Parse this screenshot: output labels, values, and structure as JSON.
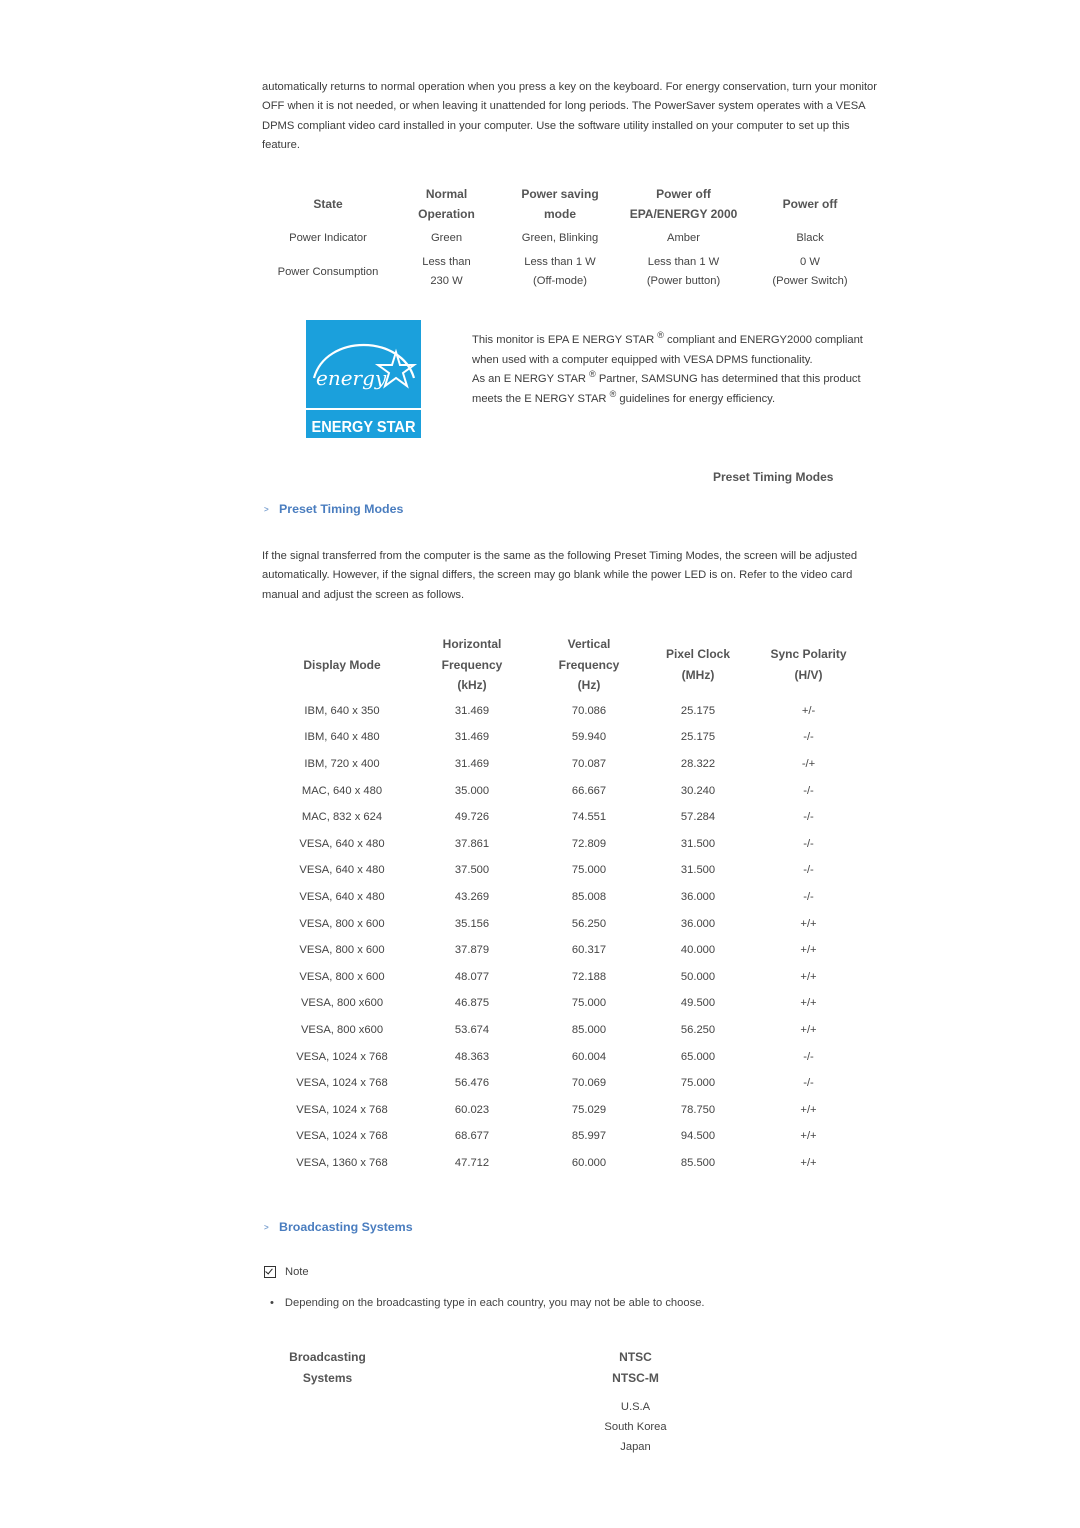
{
  "intro_paragraph": "automatically returns to normal operation when you press a key on the keyboard. For energy conservation, turn your monitor OFF when it is not needed, or when leaving it unattended for long periods. The PowerSaver system operates with a VESA DPMS compliant video card installed in your computer. Use the software utility installed on your computer to set up this feature.",
  "power_table": {
    "headers": [
      {
        "line1": "State",
        "line2": ""
      },
      {
        "line1": "Normal",
        "line2": "Operation"
      },
      {
        "line1": "Power saving",
        "line2": "mode"
      },
      {
        "line1": "Power off",
        "line2": "EPA/ENERGY 2000"
      },
      {
        "line1": "Power off",
        "line2": ""
      }
    ],
    "rows": [
      {
        "label": "Power Indicator",
        "cells": [
          {
            "line1": "Green",
            "line2": ""
          },
          {
            "line1": "Green, Blinking",
            "line2": ""
          },
          {
            "line1": "Amber",
            "line2": ""
          },
          {
            "line1": "Black",
            "line2": ""
          }
        ]
      },
      {
        "label": "Power Consumption",
        "cells": [
          {
            "line1": "Less than",
            "line2": "230 W"
          },
          {
            "line1": "Less than 1 W",
            "line2": "(Off-mode)"
          },
          {
            "line1": "Less than 1 W",
            "line2": "(Power button)"
          },
          {
            "line1": "0 W",
            "line2": "(Power Switch)"
          }
        ]
      }
    ]
  },
  "energy_star": {
    "logo_script": "energy",
    "logo_label": "ENERGY STAR",
    "brand_color": "#1ba0dc",
    "p1_a": "This monitor is EPA E NERGY STAR",
    "p1_b": " compliant and ENERGY2000 compliant when used with a computer equipped with VESA DPMS functionality.",
    "p2_a": "As an E NERGY STAR",
    "p2_b": " Partner, SAMSUNG has determined that this product meets the E NERGY STAR",
    "p2_c": " guidelines for energy efficiency.",
    "reg_mark": "®"
  },
  "right_heading": "Preset Timing Modes",
  "section_preset": {
    "arrow": ">",
    "title": "Preset Timing Modes",
    "paragraph": "If the signal transferred from the computer is the same as the following Preset Timing Modes, the screen will be adjusted automatically. However, if the signal differs, the screen may go blank while the power LED is on. Refer to the video card manual and adjust the screen as follows."
  },
  "timing_table": {
    "headers": [
      {
        "lines": [
          "Display Mode"
        ]
      },
      {
        "lines": [
          "Horizontal",
          "Frequency",
          "(kHz)"
        ]
      },
      {
        "lines": [
          "Vertical",
          "Frequency",
          "(Hz)"
        ]
      },
      {
        "lines": [
          "Pixel Clock",
          "(MHz)"
        ]
      },
      {
        "lines": [
          "Sync Polarity",
          "(H/V)"
        ]
      }
    ],
    "rows": [
      [
        "IBM, 640 x 350",
        "31.469",
        "70.086",
        "25.175",
        "+/-"
      ],
      [
        "IBM, 640 x 480",
        "31.469",
        "59.940",
        "25.175",
        "-/-"
      ],
      [
        "IBM, 720 x 400",
        "31.469",
        "70.087",
        "28.322",
        "-/+"
      ],
      [
        "MAC, 640 x 480",
        "35.000",
        "66.667",
        "30.240",
        "-/-"
      ],
      [
        "MAC, 832 x 624",
        "49.726",
        "74.551",
        "57.284",
        "-/-"
      ],
      [
        "VESA, 640 x 480",
        "37.861",
        "72.809",
        "31.500",
        "-/-"
      ],
      [
        "VESA, 640 x 480",
        "37.500",
        "75.000",
        "31.500",
        "-/-"
      ],
      [
        "VESA, 640 x 480",
        "43.269",
        "85.008",
        "36.000",
        "-/-"
      ],
      [
        "VESA, 800 x 600",
        "35.156",
        "56.250",
        "36.000",
        "+/+"
      ],
      [
        "VESA, 800 x 600",
        "37.879",
        "60.317",
        "40.000",
        "+/+"
      ],
      [
        "VESA, 800 x 600",
        "48.077",
        "72.188",
        "50.000",
        "+/+"
      ],
      [
        "VESA, 800 x600",
        "46.875",
        "75.000",
        "49.500",
        "+/+"
      ],
      [
        "VESA, 800 x600",
        "53.674",
        "85.000",
        "56.250",
        "+/+"
      ],
      [
        "VESA, 1024 x 768",
        "48.363",
        "60.004",
        "65.000",
        "-/-"
      ],
      [
        "VESA, 1024 x 768",
        "56.476",
        "70.069",
        "75.000",
        "-/-"
      ],
      [
        "VESA, 1024 x 768",
        "60.023",
        "75.029",
        "78.750",
        "+/+"
      ],
      [
        "VESA, 1024 x 768",
        "68.677",
        "85.997",
        "94.500",
        "+/+"
      ],
      [
        "VESA, 1360 x 768",
        "47.712",
        "60.000",
        "85.500",
        "+/+"
      ]
    ]
  },
  "section_broadcast": {
    "arrow": ">",
    "title": "Broadcasting Systems",
    "note_label": "Note",
    "bullet": "Depending on the broadcasting type in each country, you may not be able to choose.",
    "label_line1": "Broadcasting",
    "label_line2": "Systems",
    "col_header1": "NTSC",
    "col_header2": "NTSC-M",
    "countries": [
      "U.S.A",
      "South Korea",
      "Japan"
    ]
  }
}
